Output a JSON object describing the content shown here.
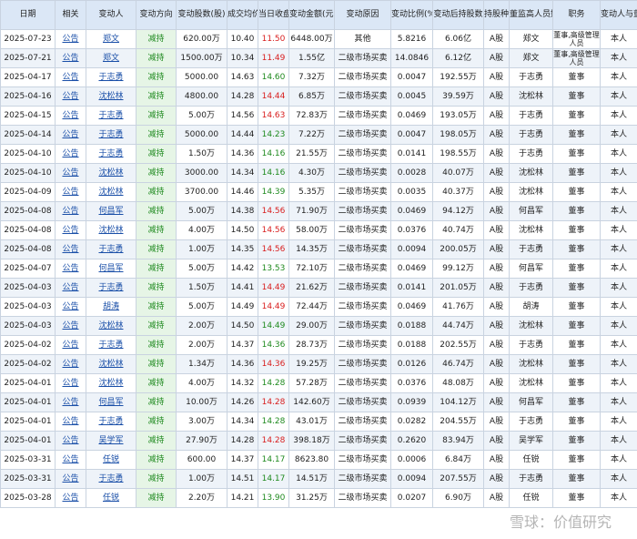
{
  "headers": [
    "日期",
    "相关",
    "变动人",
    "变动方向",
    "变动股数(股)",
    "成交均价",
    "当日收盘价",
    "变动金额(元)",
    "变动原因",
    "变动比例(‰)",
    "变动后持股数",
    "持股种类",
    "董监高人员姓名",
    "职务",
    "变动人与董监高的关系"
  ],
  "rows": [
    [
      "2025-07-23",
      "公告",
      "郑文",
      "减持",
      "620.00万",
      "10.40",
      "11.50",
      "6448.00万",
      "其他",
      "5.8216",
      "6.06亿",
      "A股",
      "郑文",
      "董事,高级管理人员",
      "本人"
    ],
    [
      "2025-07-21",
      "公告",
      "郑文",
      "减持",
      "1500.00万",
      "10.34",
      "11.49",
      "1.55亿",
      "二级市场买卖",
      "14.0846",
      "6.12亿",
      "A股",
      "郑文",
      "董事,高级管理人员",
      "本人"
    ],
    [
      "2025-04-17",
      "公告",
      "于志勇",
      "减持",
      "5000.00",
      "14.63",
      "14.60",
      "7.32万",
      "二级市场买卖",
      "0.0047",
      "192.55万",
      "A股",
      "于志勇",
      "董事",
      "本人"
    ],
    [
      "2025-04-16",
      "公告",
      "沈松林",
      "减持",
      "4800.00",
      "14.28",
      "14.44",
      "6.85万",
      "二级市场买卖",
      "0.0045",
      "39.59万",
      "A股",
      "沈松林",
      "董事",
      "本人"
    ],
    [
      "2025-04-15",
      "公告",
      "于志勇",
      "减持",
      "5.00万",
      "14.56",
      "14.63",
      "72.83万",
      "二级市场买卖",
      "0.0469",
      "193.05万",
      "A股",
      "于志勇",
      "董事",
      "本人"
    ],
    [
      "2025-04-14",
      "公告",
      "于志勇",
      "减持",
      "5000.00",
      "14.44",
      "14.23",
      "7.22万",
      "二级市场买卖",
      "0.0047",
      "198.05万",
      "A股",
      "于志勇",
      "董事",
      "本人"
    ],
    [
      "2025-04-10",
      "公告",
      "于志勇",
      "减持",
      "1.50万",
      "14.36",
      "14.16",
      "21.55万",
      "二级市场买卖",
      "0.0141",
      "198.55万",
      "A股",
      "于志勇",
      "董事",
      "本人"
    ],
    [
      "2025-04-10",
      "公告",
      "沈松林",
      "减持",
      "3000.00",
      "14.34",
      "14.16",
      "4.30万",
      "二级市场买卖",
      "0.0028",
      "40.07万",
      "A股",
      "沈松林",
      "董事",
      "本人"
    ],
    [
      "2025-04-09",
      "公告",
      "沈松林",
      "减持",
      "3700.00",
      "14.46",
      "14.39",
      "5.35万",
      "二级市场买卖",
      "0.0035",
      "40.37万",
      "A股",
      "沈松林",
      "董事",
      "本人"
    ],
    [
      "2025-04-08",
      "公告",
      "何昌军",
      "减持",
      "5.00万",
      "14.38",
      "14.56",
      "71.90万",
      "二级市场买卖",
      "0.0469",
      "94.12万",
      "A股",
      "何昌军",
      "董事",
      "本人"
    ],
    [
      "2025-04-08",
      "公告",
      "沈松林",
      "减持",
      "4.00万",
      "14.50",
      "14.56",
      "58.00万",
      "二级市场买卖",
      "0.0376",
      "40.74万",
      "A股",
      "沈松林",
      "董事",
      "本人"
    ],
    [
      "2025-04-08",
      "公告",
      "于志勇",
      "减持",
      "1.00万",
      "14.35",
      "14.56",
      "14.35万",
      "二级市场买卖",
      "0.0094",
      "200.05万",
      "A股",
      "于志勇",
      "董事",
      "本人"
    ],
    [
      "2025-04-07",
      "公告",
      "何昌军",
      "减持",
      "5.00万",
      "14.42",
      "13.53",
      "72.10万",
      "二级市场买卖",
      "0.0469",
      "99.12万",
      "A股",
      "何昌军",
      "董事",
      "本人"
    ],
    [
      "2025-04-03",
      "公告",
      "于志勇",
      "减持",
      "1.50万",
      "14.41",
      "14.49",
      "21.62万",
      "二级市场买卖",
      "0.0141",
      "201.05万",
      "A股",
      "于志勇",
      "董事",
      "本人"
    ],
    [
      "2025-04-03",
      "公告",
      "胡涛",
      "减持",
      "5.00万",
      "14.49",
      "14.49",
      "72.44万",
      "二级市场买卖",
      "0.0469",
      "41.76万",
      "A股",
      "胡涛",
      "董事",
      "本人"
    ],
    [
      "2025-04-03",
      "公告",
      "沈松林",
      "减持",
      "2.00万",
      "14.50",
      "14.49",
      "29.00万",
      "二级市场买卖",
      "0.0188",
      "44.74万",
      "A股",
      "沈松林",
      "董事",
      "本人"
    ],
    [
      "2025-04-02",
      "公告",
      "于志勇",
      "减持",
      "2.00万",
      "14.37",
      "14.36",
      "28.73万",
      "二级市场买卖",
      "0.0188",
      "202.55万",
      "A股",
      "于志勇",
      "董事",
      "本人"
    ],
    [
      "2025-04-02",
      "公告",
      "沈松林",
      "减持",
      "1.34万",
      "14.36",
      "14.36",
      "19.25万",
      "二级市场买卖",
      "0.0126",
      "46.74万",
      "A股",
      "沈松林",
      "董事",
      "本人"
    ],
    [
      "2025-04-01",
      "公告",
      "沈松林",
      "减持",
      "4.00万",
      "14.32",
      "14.28",
      "57.28万",
      "二级市场买卖",
      "0.0376",
      "48.08万",
      "A股",
      "沈松林",
      "董事",
      "本人"
    ],
    [
      "2025-04-01",
      "公告",
      "何昌军",
      "减持",
      "10.00万",
      "14.26",
      "14.28",
      "142.60万",
      "二级市场买卖",
      "0.0939",
      "104.12万",
      "A股",
      "何昌军",
      "董事",
      "本人"
    ],
    [
      "2025-04-01",
      "公告",
      "于志勇",
      "减持",
      "3.00万",
      "14.34",
      "14.28",
      "43.01万",
      "二级市场买卖",
      "0.0282",
      "204.55万",
      "A股",
      "于志勇",
      "董事",
      "本人"
    ],
    [
      "2025-04-01",
      "公告",
      "吴学军",
      "减持",
      "27.90万",
      "14.28",
      "14.28",
      "398.18万",
      "二级市场买卖",
      "0.2620",
      "83.94万",
      "A股",
      "吴学军",
      "董事",
      "本人"
    ],
    [
      "2025-03-31",
      "公告",
      "任锐",
      "减持",
      "600.00",
      "14.37",
      "14.17",
      "8623.80",
      "二级市场买卖",
      "0.0006",
      "6.84万",
      "A股",
      "任锐",
      "董事",
      "本人"
    ],
    [
      "2025-03-31",
      "公告",
      "于志勇",
      "减持",
      "1.00万",
      "14.51",
      "14.17",
      "14.51万",
      "二级市场买卖",
      "0.0094",
      "207.55万",
      "A股",
      "于志勇",
      "董事",
      "本人"
    ],
    [
      "2025-03-28",
      "公告",
      "任锐",
      "减持",
      "2.20万",
      "14.21",
      "13.90",
      "31.25万",
      "二级市场买卖",
      "0.0207",
      "6.90万",
      "A股",
      "任锐",
      "董事",
      "本人"
    ]
  ],
  "watermark": "雪球：价值研究"
}
